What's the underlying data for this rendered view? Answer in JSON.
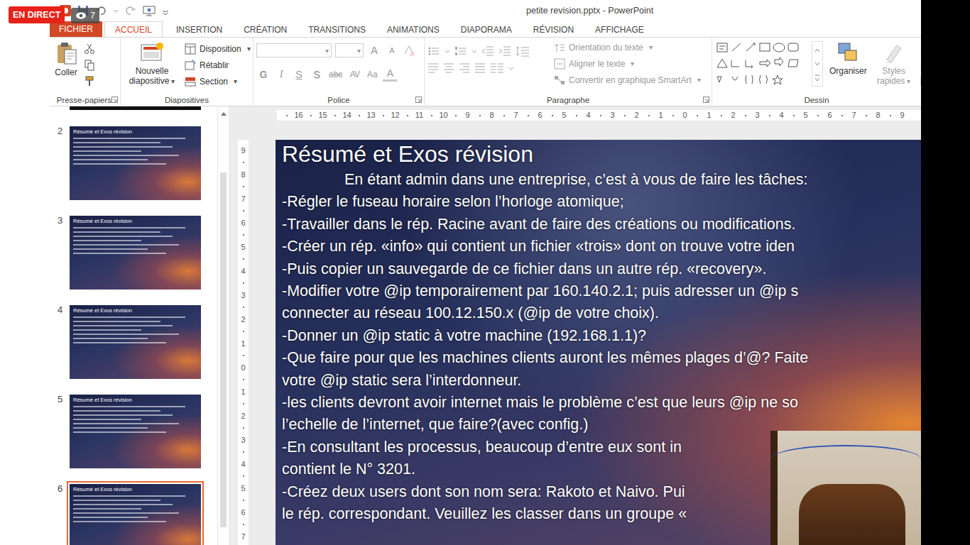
{
  "stream": {
    "badge": "EN DIRECT",
    "viewers": "7"
  },
  "window": {
    "title": "petite revision.pptx - PowerPoint"
  },
  "file_tab": {
    "label": "FICHIER"
  },
  "tabs": [
    {
      "label": "ACCUEIL",
      "selected": true
    },
    {
      "label": "INSERTION",
      "selected": false
    },
    {
      "label": "CRÉATION",
      "selected": false
    },
    {
      "label": "TRANSITIONS",
      "selected": false
    },
    {
      "label": "ANIMATIONS",
      "selected": false
    },
    {
      "label": "DIAPORAMA",
      "selected": false
    },
    {
      "label": "RÉVISION",
      "selected": false
    },
    {
      "label": "AFFICHAGE",
      "selected": false
    }
  ],
  "ribbon": {
    "clipboard": {
      "label": "Presse-papiers",
      "paste": "Coller"
    },
    "slides": {
      "label": "Diapositives",
      "new_slide": {
        "label": "Nouvelle diapositive",
        "caret": "▾"
      },
      "items": [
        {
          "label": "Disposition",
          "caret": "▾"
        },
        {
          "label": "Rétablir"
        },
        {
          "label": "Section",
          "caret": "▾"
        }
      ]
    },
    "font": {
      "label": "Police",
      "disabled": true,
      "font_caret": "▾",
      "size_caret": "▾",
      "grow": "A",
      "shrink": "A",
      "glyphs": [
        {
          "label": "G",
          "kind": "bold"
        },
        {
          "label": "I",
          "kind": "italic"
        },
        {
          "label": "S",
          "kind": "underline"
        },
        {
          "label": "S",
          "kind": "shadow"
        },
        {
          "label": "abc",
          "kind": "strike"
        },
        {
          "label": "AV",
          "kind": "spacing"
        },
        {
          "label": "Aa",
          "kind": "case"
        },
        {
          "label": "A",
          "kind": "color"
        }
      ]
    },
    "paragraph": {
      "label": "Paragraphe",
      "disabled": true,
      "items": [
        {
          "label": "Orientation du texte",
          "caret": "▾"
        },
        {
          "label": "Aligner le texte",
          "caret": "▾"
        },
        {
          "label": "Convertir en graphique SmartArt",
          "caret": "▾"
        }
      ]
    },
    "drawing": {
      "label": "Dessin",
      "arrange": {
        "label": "Organiser",
        "disabled": false
      },
      "styles": {
        "label": "Styles rapides",
        "caret": "▾",
        "disabled": true
      }
    }
  },
  "thumbnails": [
    {
      "number": "2",
      "title": "Résumé et Exos révision",
      "selected": false
    },
    {
      "number": "3",
      "title": "Résumé et Exos révision",
      "selected": false
    },
    {
      "number": "4",
      "title": "Résumé et Exos révision",
      "selected": false
    },
    {
      "number": "5",
      "title": "Résumé et Exos révision",
      "selected": false
    },
    {
      "number": "6",
      "title": "Résumé et Exos révision",
      "selected": true
    }
  ],
  "rulers": {
    "horizontal": [
      "16",
      "15",
      "14",
      "13",
      "12",
      "11",
      "10",
      "9",
      "8",
      "7",
      "6",
      "5",
      "4",
      "3",
      "2",
      "1",
      "0",
      "1",
      "2",
      "3",
      "4",
      "5",
      "6",
      "7",
      "8",
      "9"
    ],
    "vertical": [
      "9",
      "8",
      "7",
      "6",
      "5",
      "4",
      "3",
      "2",
      "1",
      "0",
      "1",
      "2",
      "3",
      "4",
      "5",
      "6",
      "7"
    ]
  },
  "slide": {
    "title": "Résumé et Exos révision",
    "lines": [
      {
        "text": "En étant admin dans une entreprise, c’est à vous de faire les tâches:",
        "kind": "intro"
      },
      {
        "text": "-Régler le fuseau horaire selon l’horloge atomique;",
        "kind": "line"
      },
      {
        "text": "-Travailler dans le rép. Racine avant de faire des créations ou modifications.",
        "kind": "line"
      },
      {
        "text": "-Créer un rép. «info» qui contient un fichier «trois» dont on trouve votre iden",
        "kind": "line"
      },
      {
        "text": "-Puis copier un sauvegarde de ce fichier dans un autre rép. «recovery».",
        "kind": "line"
      },
      {
        "text": "-Modifier votre @ip temporairement par 160.140.2.1; puis adresser un @ip s",
        "kind": "line"
      },
      {
        "text": "connecter au réseau 100.12.150.x (@ip de votre choix).",
        "kind": "line"
      },
      {
        "text": "-Donner un @ip static à votre machine (192.168.1.1)?",
        "kind": "line"
      },
      {
        "text": "-Que faire pour que les machines clients auront les mêmes plages d’@? Faite",
        "kind": "line"
      },
      {
        "text": "votre @ip static sera l’interdonneur.",
        "kind": "line"
      },
      {
        "text": "-les clients devront avoir internet mais le problème c’est que leurs @ip ne so",
        "kind": "line"
      },
      {
        "text": "l’echelle de l’internet, que faire?(avec config.)",
        "kind": "line"
      },
      {
        "text": "-En consultant les processus, beaucoup d’entre eux sont in",
        "kind": "line"
      },
      {
        "text": "contient le N° 3201.",
        "kind": "line"
      },
      {
        "text": "-Créez deux users dont son nom sera: Rakoto et Naivo. Pui",
        "kind": "line"
      },
      {
        "text": "le rép. correspondant. Veuillez les classer dans un groupe «",
        "kind": "line"
      }
    ]
  }
}
